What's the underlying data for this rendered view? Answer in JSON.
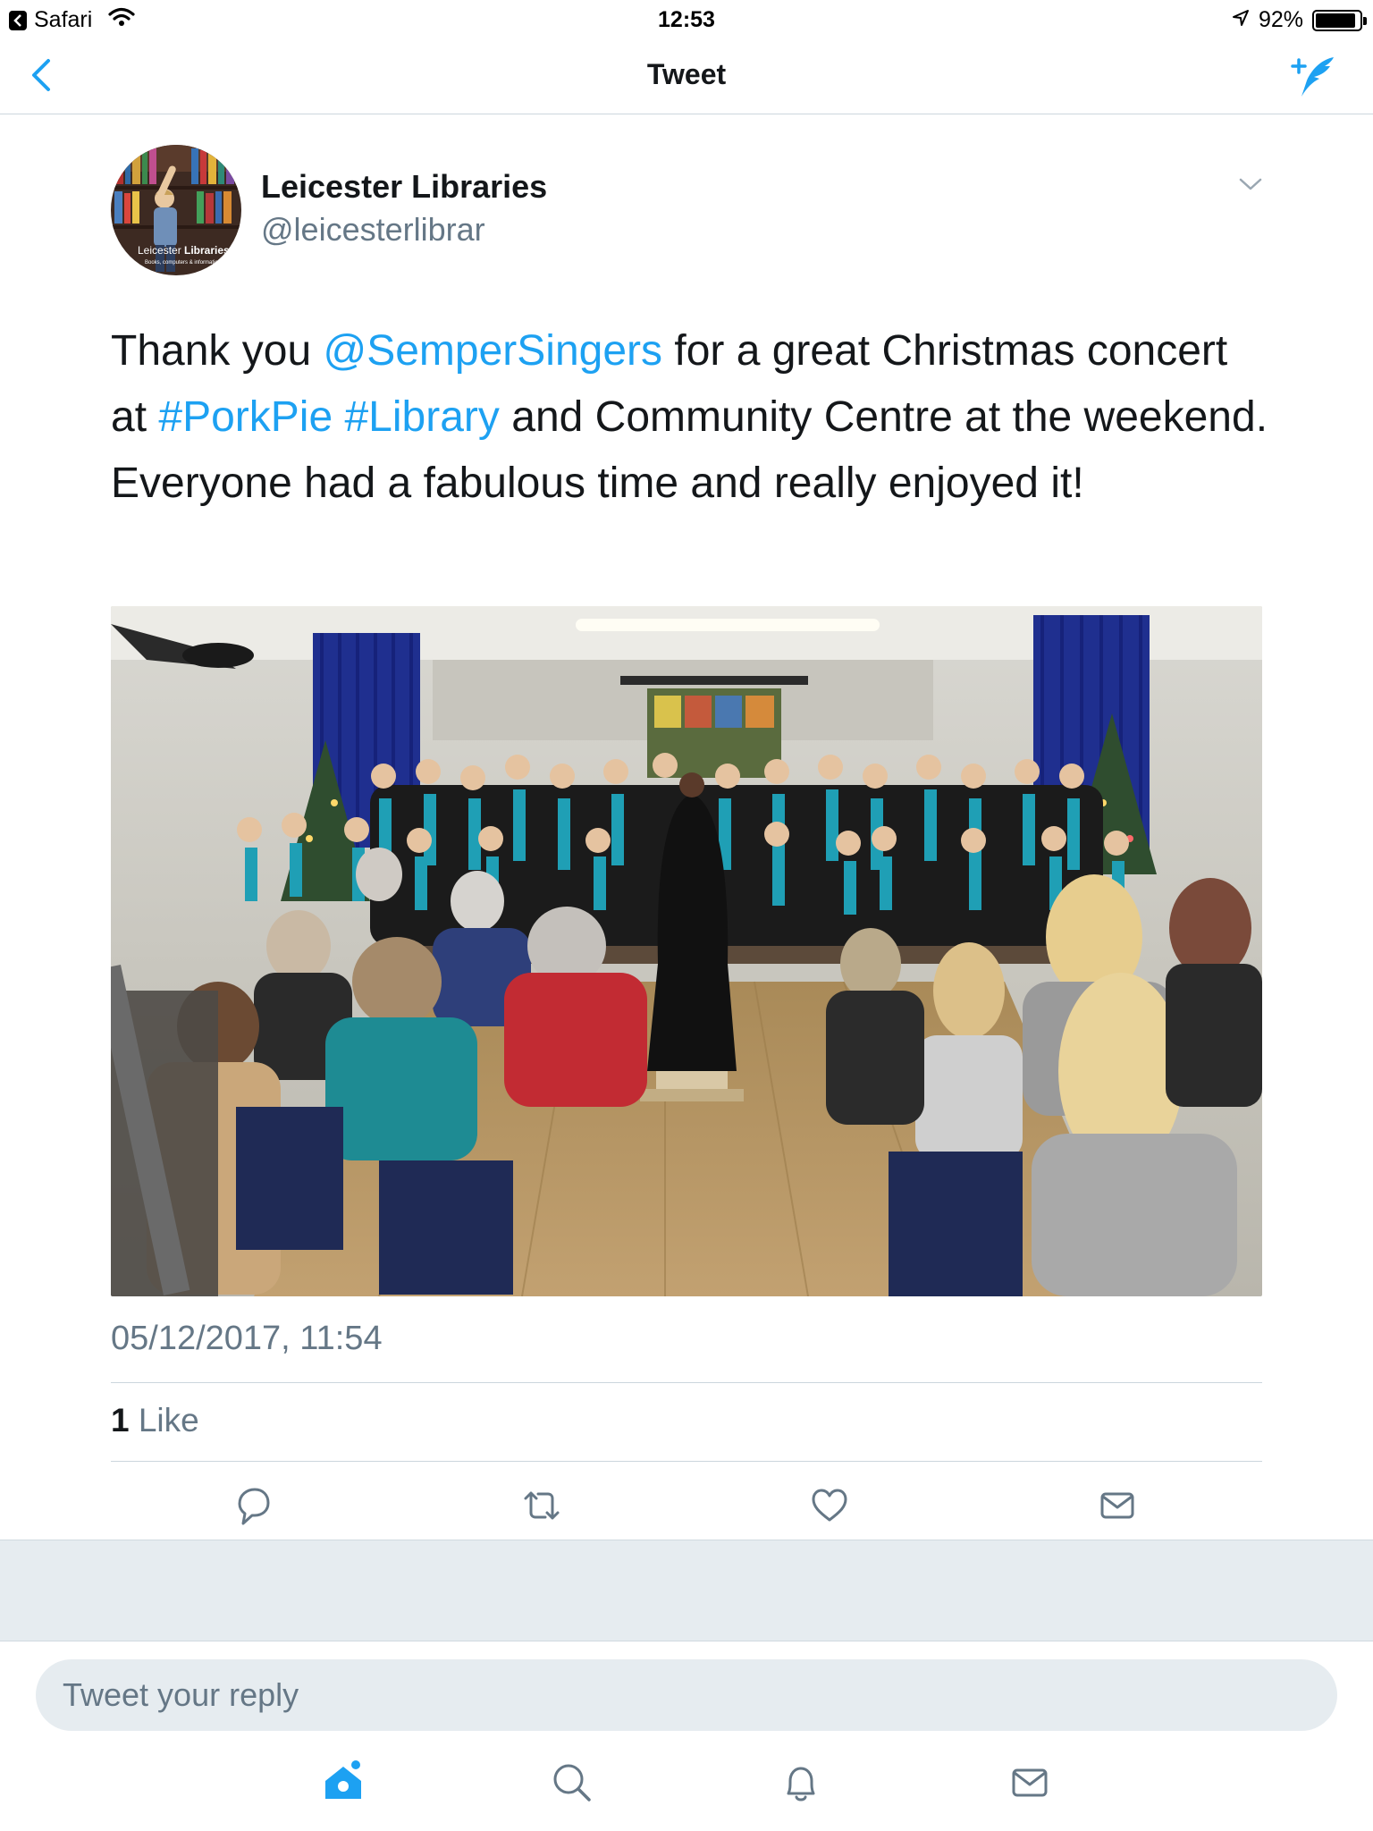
{
  "status_bar": {
    "back_app": "Safari",
    "time": "12:53",
    "battery": "92%",
    "battery_level": 0.92
  },
  "nav": {
    "title": "Tweet",
    "back_icon": "chevron-left-icon",
    "compose_icon": "compose-tweet-icon"
  },
  "tweet": {
    "author_name": "Leicester Libraries",
    "author_handle": "@leicesterlibrar",
    "avatar_label": "Leicester Libraries",
    "text_parts": {
      "p1": "Thank you ",
      "mention": "@SemperSingers",
      "p2": " for a great Christmas concert at ",
      "hashtag1": "#PorkPie",
      "p3": " ",
      "hashtag2": "#Library",
      "p4": " and Community Centre at the weekend. Everyone had a fabulous time and really enjoyed it!"
    },
    "timestamp": "05/12/2017, 11:54",
    "likes_count": "1",
    "likes_label": " Like"
  },
  "actions": [
    {
      "name": "reply",
      "icon": "reply-icon"
    },
    {
      "name": "retweet",
      "icon": "retweet-icon"
    },
    {
      "name": "like",
      "icon": "heart-icon"
    },
    {
      "name": "share",
      "icon": "envelope-icon"
    }
  ],
  "reply": {
    "placeholder": "Tweet your reply"
  },
  "tabs": [
    {
      "name": "home",
      "icon": "home-icon",
      "active": true
    },
    {
      "name": "search",
      "icon": "search-icon"
    },
    {
      "name": "notifications",
      "icon": "bell-icon"
    },
    {
      "name": "messages",
      "icon": "envelope-icon"
    }
  ],
  "colors": {
    "accent": "#1da1f2",
    "text": "#14171a",
    "secondary": "#657786",
    "divider": "#ccd6dd",
    "gap": "#e6ecf0"
  }
}
